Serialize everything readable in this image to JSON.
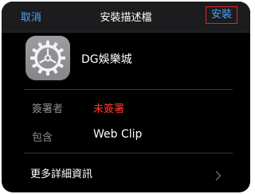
{
  "nav": {
    "cancel_label": "取消",
    "title": "安裝描述檔",
    "install_label": "安裝"
  },
  "profile": {
    "icon": "settings-gear-icon",
    "name": "DG娛樂城"
  },
  "details": {
    "signer_label": "簽署者",
    "signer_value": "未簽署",
    "contains_label": "包含",
    "contains_value": "Web Clip"
  },
  "more": {
    "label": "更多詳細資訊",
    "icon": "chevron-right-icon"
  },
  "colors": {
    "link": "#4da3ff",
    "unsigned": "#ff3b30",
    "highlight_box": "#e0242a"
  }
}
